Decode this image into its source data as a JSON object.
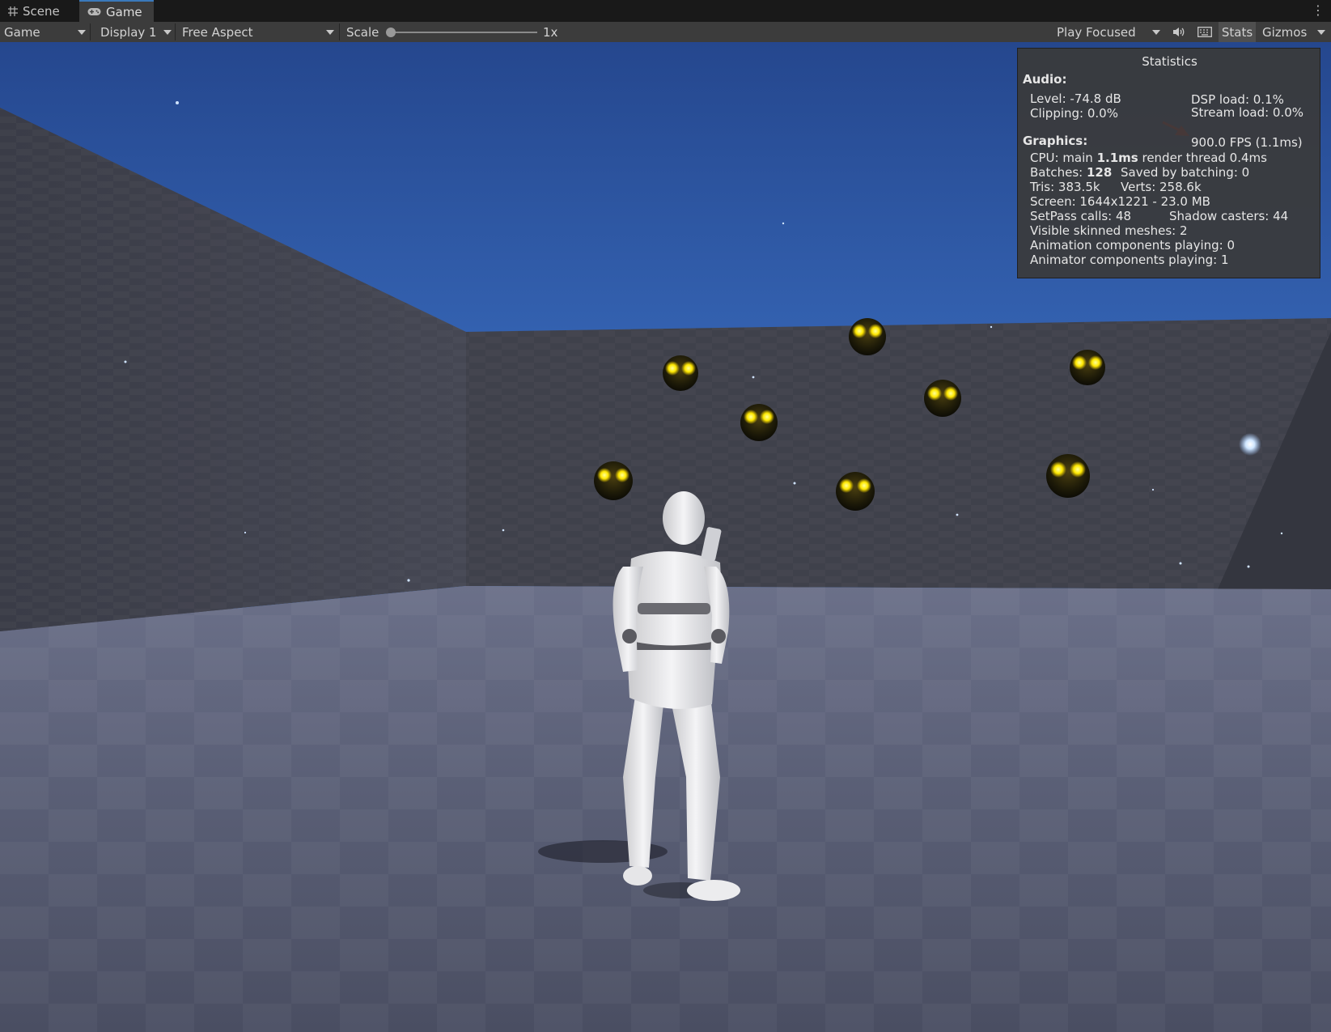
{
  "tabs": {
    "scene": {
      "label": "Scene",
      "icon": "grid-icon"
    },
    "game": {
      "label": "Game",
      "icon": "gamepad-icon"
    }
  },
  "toolbar": {
    "game_mode": "Game",
    "display": "Display 1",
    "aspect": "Free Aspect",
    "scale_label": "Scale",
    "scale_value": "1x",
    "play_mode": "Play Focused",
    "stats_label": "Stats",
    "gizmos_label": "Gizmos"
  },
  "stats": {
    "title": "Statistics",
    "audio_heading": "Audio:",
    "level": "Level: -74.8 dB",
    "dsp_load": "DSP load: 0.1%",
    "clipping": "Clipping: 0.0%",
    "stream_load": "Stream load: 0.0%",
    "graphics_heading": "Graphics:",
    "fps": "900.0 FPS (1.1ms)",
    "cpu_label": "CPU: main ",
    "cpu_main": "1.1ms",
    "cpu_render": "  render thread 0.4ms",
    "batches_label": "Batches: ",
    "batches_value": "128",
    "saved_by_batching": "Saved by batching: 0",
    "tris": "Tris: 383.5k",
    "verts": "Verts: 258.6k",
    "screen": "Screen: 1644x1221 - 23.0 MB",
    "setpass": "SetPass calls: 48",
    "shadow_casters": "Shadow casters: 44",
    "skinned_meshes": "Visible skinned meshes: 2",
    "animation_components": "Animation components playing: 0",
    "animator_components": "Animator components playing: 1"
  },
  "colors": {
    "sky_top": "#26488f",
    "sky_bottom": "#3f76c9",
    "wall": "#3f414a",
    "floor": "#5a5f74",
    "orb_glow": "#ffe800",
    "annotation_arrow": "#e02020",
    "tab_accent": "#3a79bb"
  }
}
